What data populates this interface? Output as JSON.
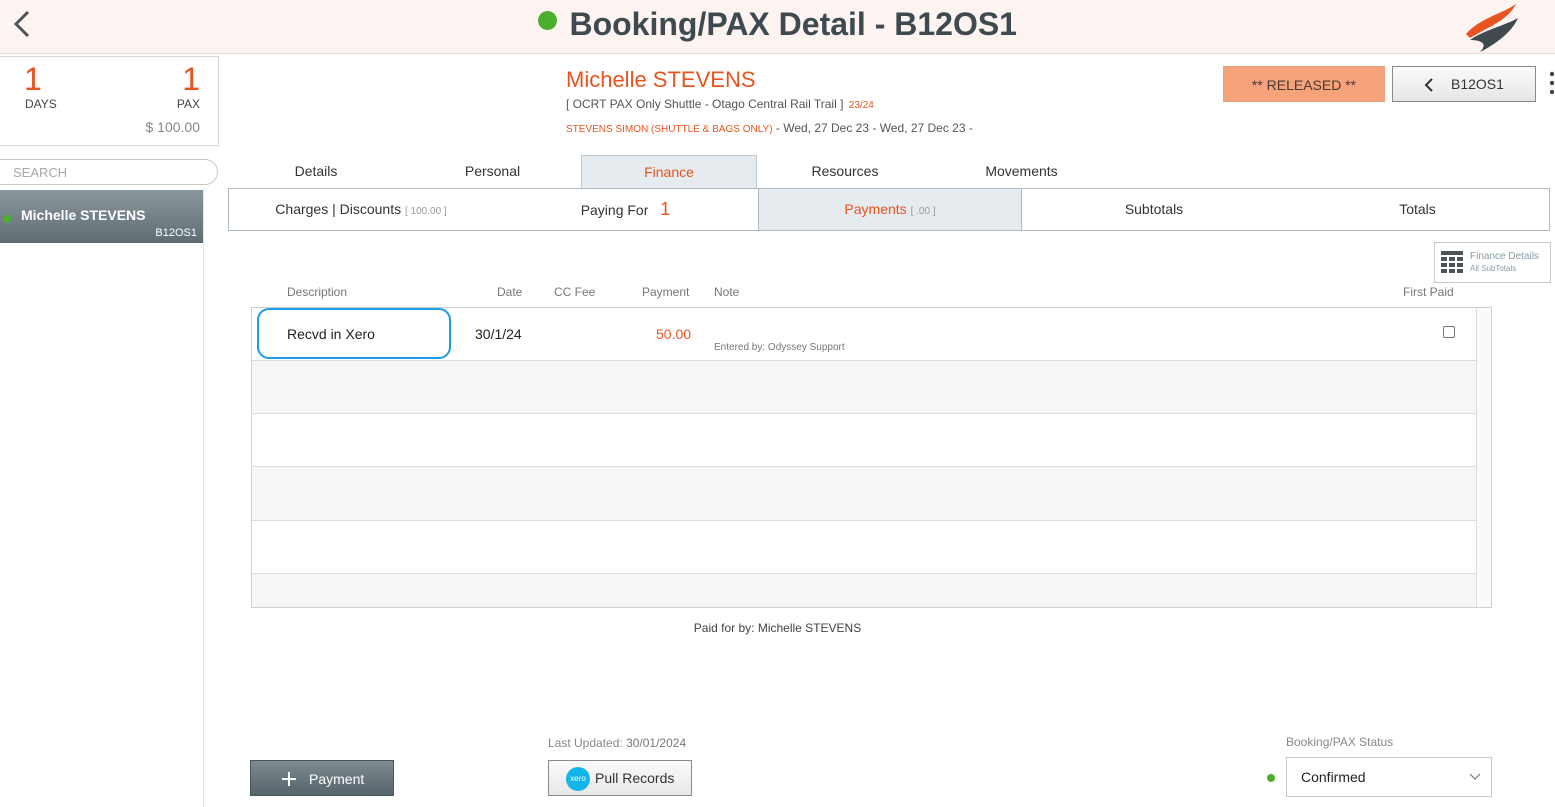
{
  "header": {
    "title": "Booking/PAX Detail - B12OS1",
    "status_color": "#4cae2e"
  },
  "stats": {
    "days_value": "1",
    "days_label": "DAYS",
    "pax_value": "1",
    "pax_label": "PAX",
    "amount": "$ 100.00"
  },
  "search": {
    "placeholder": "SEARCH"
  },
  "pax_list": [
    {
      "name": "Michelle STEVENS",
      "code": "B12OS1"
    }
  ],
  "booking": {
    "guest_name": "Michelle STEVENS",
    "trip": "[ OCRT PAX Only Shuttle - Otago Central Rail Trail ]",
    "season": "23/24",
    "booker": "STEVENS SIMON (SHUTTLE & BAGS ONLY)",
    "dates": " - Wed, 27 Dec 23 - Wed, 27 Dec 23 -",
    "status_badge": "** RELEASED **",
    "nav_code": "B12OS1"
  },
  "tabs": [
    "Details",
    "Personal",
    "Finance",
    "Resources",
    "Movements"
  ],
  "active_tab": "Finance",
  "subtabs": {
    "charges": "Charges | Discounts",
    "charges_amount": "[ 100.00 ]",
    "paying_for": "Paying For",
    "paying_for_count": "1",
    "payments": "Payments",
    "payments_amount": "[ .00 ]",
    "subtotals": "Subtotals",
    "totals": "Totals"
  },
  "finance_details": {
    "title": "Finance Details",
    "subtitle": "All SubTotals"
  },
  "table": {
    "headers": {
      "description": "Description",
      "date": "Date",
      "cc_fee": "CC Fee",
      "payment": "Payment",
      "note": "Note",
      "first_paid": "First Paid"
    },
    "rows": [
      {
        "description": "Recvd in Xero",
        "date": "30/1/24",
        "cc_fee": "",
        "payment": "50.00",
        "note": "Entered by: Odyssey Support",
        "first_paid": false
      }
    ]
  },
  "paid_for_by": "Paid for by: Michelle STEVENS",
  "footer": {
    "add_payment": "Payment",
    "last_updated_label": "Last Updated:",
    "last_updated_value": "30/01/2024",
    "pull_records": "Pull Records",
    "xero_icon_text": "xero",
    "status_label": "Booking/PAX Status",
    "status_value": "Confirmed"
  },
  "colors": {
    "accent": "#e8541f",
    "released": "#f6a37b",
    "xero": "#13b5ea",
    "active_green": "#4cae2e"
  },
  "icons": [
    "chevron-left-icon",
    "brand-logo",
    "more-vertical-icon",
    "table-grid-icon",
    "plus-icon",
    "xero-icon",
    "chevron-down-icon"
  ]
}
